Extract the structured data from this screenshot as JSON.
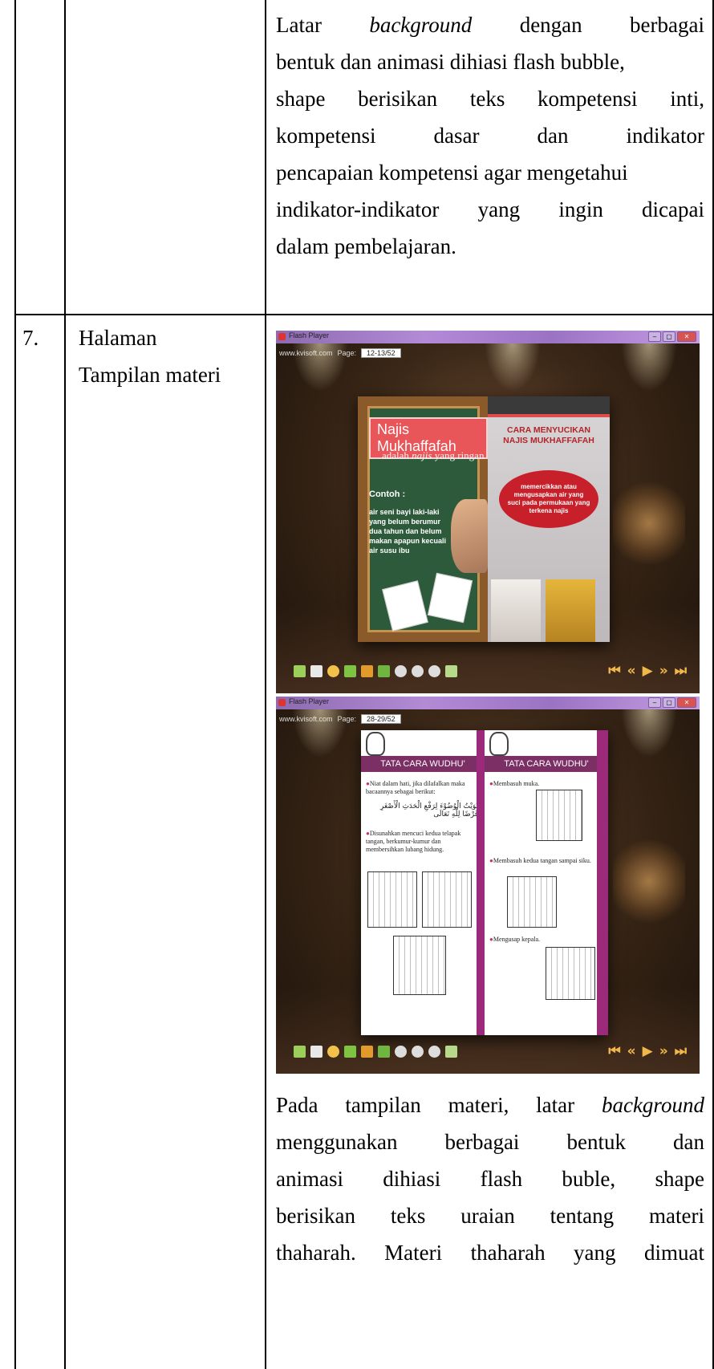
{
  "table": {
    "row6_text_lines": [
      [
        "Latar",
        "background",
        "dengan",
        "berbagai"
      ],
      [
        "bentuk dan animasi dihiasi flash bubble,"
      ],
      [
        "shape",
        "berisikan",
        "teks",
        "kompetensi",
        "inti,"
      ],
      [
        "kompetensi",
        "dasar",
        "dan",
        "indikator"
      ],
      [
        "pencapaian kompetensi agar mengetahui"
      ],
      [
        "indikator-indikator",
        "yang",
        "ingin",
        "dicapai"
      ],
      [
        "dalam pembelajaran."
      ]
    ],
    "row7": {
      "number": "7.",
      "title_line1": "Halaman",
      "title_line2": "Tampilan materi",
      "desc_lines": [
        [
          "Pada",
          "tampilan",
          "materi,",
          "latar",
          "background"
        ],
        [
          "menggunakan",
          "berbagai",
          "bentuk",
          "dan"
        ],
        [
          "animasi",
          "dihiasi",
          "flash",
          "buble,",
          "shape"
        ],
        [
          "berisikan",
          "teks",
          "uraian",
          "tentang",
          "materi"
        ],
        [
          "thaharah.",
          "Materi",
          "thaharah",
          "yang",
          "dimuat"
        ]
      ]
    }
  },
  "screenshot1": {
    "window_title": "Flash Player",
    "site": "www.kvisoft.com",
    "page_label": "Page:",
    "page_value": "12-13/52",
    "banner": "Najis Mukhaffafah",
    "subtitle_pre": "adalah ",
    "subtitle_em": "najis",
    "subtitle_post": " yang ringan",
    "contoh": "Contoh :",
    "body": "air seni bayi laki-laki yang belum berumur dua tahun dan belum makan apapun kecuali air susu ibu",
    "right_heading_1": "CARA MENYUCIKAN",
    "right_heading_2": "NAJIS MUKHAFFAFAH",
    "cloud_text": "memercikkan atau mengusapkan air yang suci pada permukaan yang terkena najis"
  },
  "screenshot2": {
    "window_title": "Flash Player",
    "site": "www.kvisoft.com",
    "page_label": "Page:",
    "page_value": "28-29/52",
    "left_header": "TATA CARA WUDHU'",
    "right_header": "TATA CARA WUDHU'",
    "left_step1": "Niat dalam hati, jika dilafalkan maka bacaannya sebagai berikut:",
    "arabic": "نَوَيْتُ الْوُضُوْءَ لِرَفْعِ الْحَدَثِ الْأَصْغَرِ فَرْضًا لِلّٰهِ تَعَالَى",
    "left_step2": "Disunahkan mencuci kedua telapak tangan, berkumur-kumur dan membersihkan lubang hidung.",
    "right_step1": "Membasuh muka.",
    "right_step2": "Membasuh kedua tangan sampai siku.",
    "right_step3": "Mengusap kepala."
  },
  "icons": [
    "book-icon",
    "page-icon",
    "sound-icon",
    "thumbnail-icon",
    "photo-icon",
    "print-icon",
    "zoom-in-icon",
    "zoom-out-icon",
    "zoom-icon",
    "fit-icon"
  ],
  "nav": [
    "⏮",
    "«",
    "▶",
    "»",
    "⏭"
  ]
}
